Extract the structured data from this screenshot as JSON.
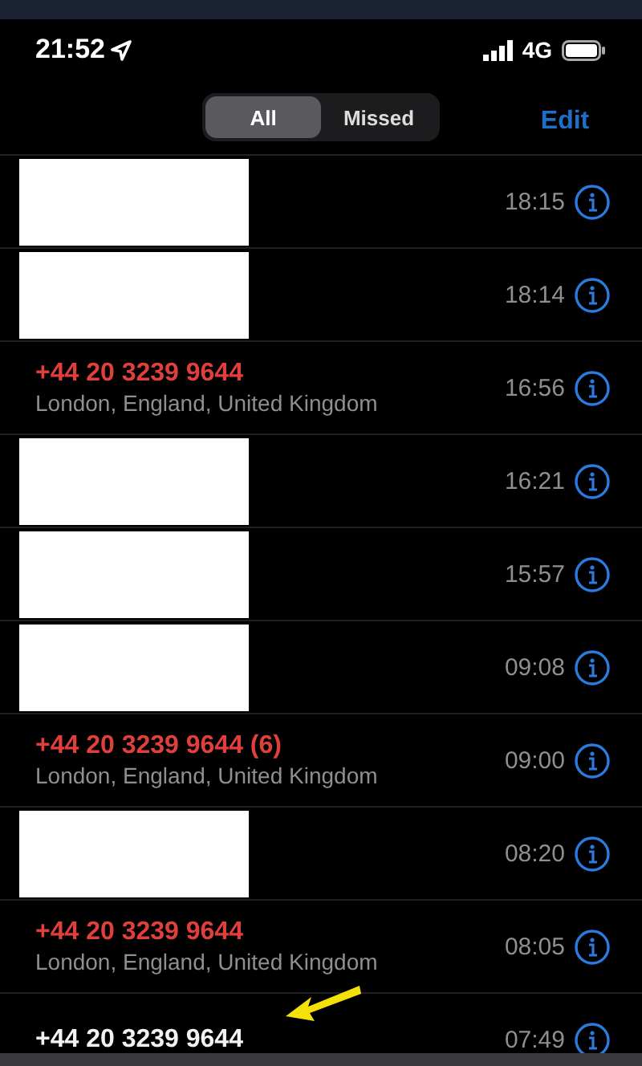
{
  "status_bar": {
    "time": "21:52",
    "network": "4G"
  },
  "segments": [
    {
      "label": "All",
      "selected": true
    },
    {
      "label": "Missed",
      "selected": false
    }
  ],
  "edit": "Edit",
  "calls": [
    {
      "kind": "redacted",
      "time": "18:15"
    },
    {
      "kind": "redacted",
      "time": "18:14"
    },
    {
      "kind": "number",
      "number": "+44 20 3239 9644",
      "missed": true,
      "location": "London, England, United Kingdom",
      "time": "16:56"
    },
    {
      "kind": "redacted",
      "time": "16:21"
    },
    {
      "kind": "redacted",
      "time": "15:57"
    },
    {
      "kind": "redacted",
      "time": "09:08"
    },
    {
      "kind": "number",
      "number": "+44 20 3239 9644 (6)",
      "missed": true,
      "location": "London, England, United Kingdom",
      "time": "09:00"
    },
    {
      "kind": "redacted",
      "time": "08:20"
    },
    {
      "kind": "number",
      "number": "+44 20 3239 9644",
      "missed": true,
      "location": "London, England, United Kingdom",
      "time": "08:05"
    },
    {
      "kind": "number",
      "number": "+44 20 3239 9644",
      "missed": false,
      "marked": true,
      "time": "07:49"
    }
  ]
}
